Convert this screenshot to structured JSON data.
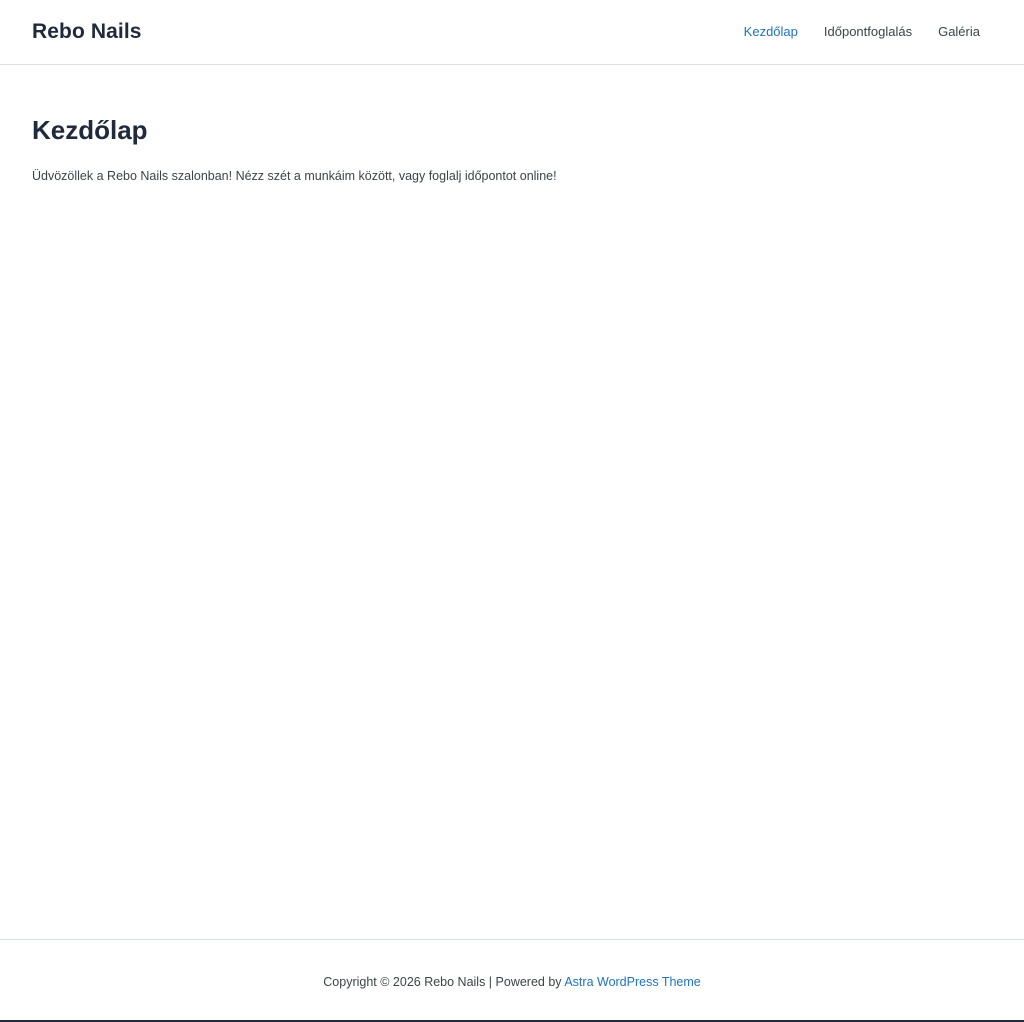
{
  "header": {
    "site_title": "Rebo Nails",
    "nav": [
      {
        "label": "Kezdőlap",
        "active": true
      },
      {
        "label": "Időpontfoglalás",
        "active": false
      },
      {
        "label": "Galéria",
        "active": false
      }
    ]
  },
  "main": {
    "title": "Kezdőlap",
    "intro": "Üdvözöllek a Rebo Nails szalonban! Nézz szét a munkáim között, vagy foglalj időpontot online!"
  },
  "footer": {
    "copyright_prefix": "Copyright © 2026 Rebo Nails | Powered by",
    "theme_link": "Astra WordPress Theme"
  },
  "colors": {
    "accent": "#1e73be",
    "heading": "#1f2a3d",
    "text": "#3c434a",
    "border": "#dcdfe3"
  }
}
